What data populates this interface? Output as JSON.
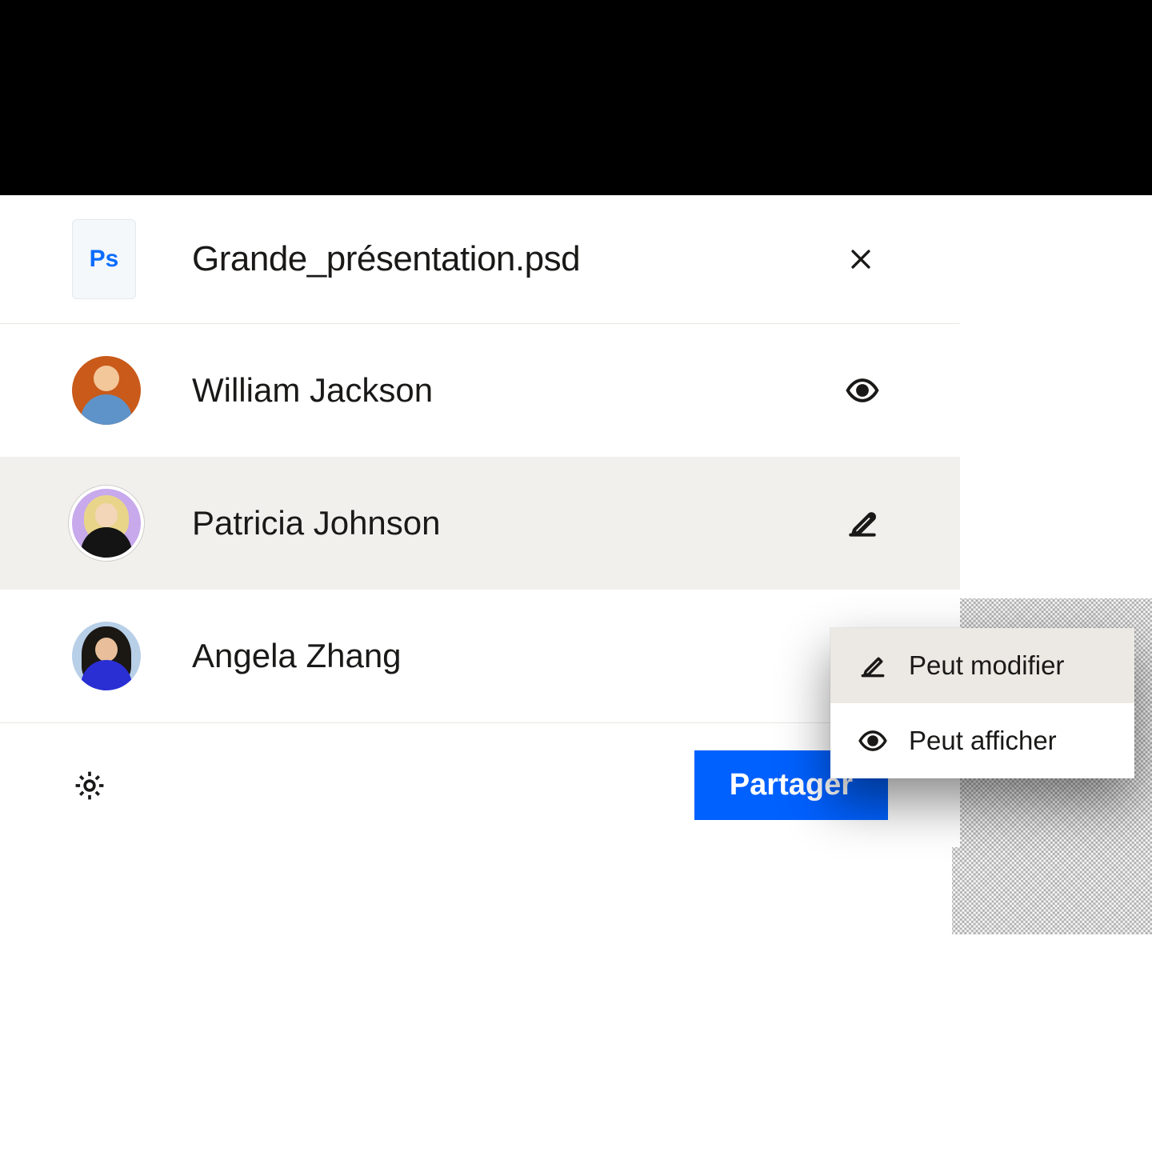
{
  "file": {
    "icon_label": "Ps",
    "name": "Grande_présentation.psd"
  },
  "people": [
    {
      "name": "William Jackson",
      "permission": "view",
      "avatar_bg": "#c95a1a",
      "face": "#f3c79a",
      "body": "#5e93c9"
    },
    {
      "name": "Patricia Johnson",
      "permission": "edit",
      "avatar_bg": "#c7a9ec",
      "face": "#f3d6b8",
      "body": "#141414",
      "hair": "#e9d58a"
    },
    {
      "name": "Angela Zhang",
      "permission": "view",
      "avatar_bg": "#b8cfe8",
      "face": "#e8bf9a",
      "body": "#2a2fd4",
      "hair": "#1b1713"
    }
  ],
  "dropdown": {
    "options": [
      {
        "key": "edit",
        "label": "Peut modifier"
      },
      {
        "key": "view",
        "label": "Peut afficher"
      }
    ],
    "active": "edit"
  },
  "footer": {
    "share_label": "Partager"
  }
}
